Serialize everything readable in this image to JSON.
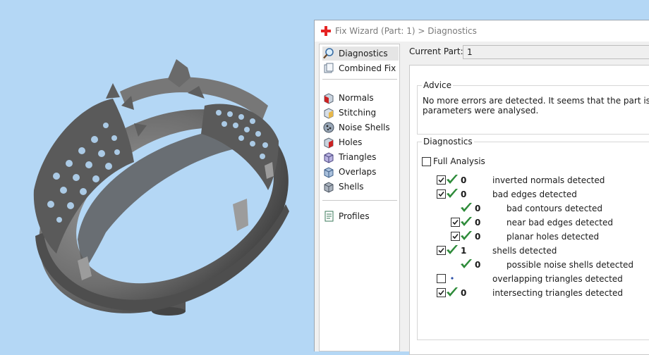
{
  "window": {
    "title": "Fix Wizard (Part: 1) > Diagnostics"
  },
  "nav": {
    "items": [
      {
        "label": "Diagnostics",
        "icon": "magnifier-icon",
        "selected": true
      },
      {
        "label": "Combined Fix",
        "icon": "combined-fix-icon"
      },
      {
        "label": "Normals",
        "icon": "normals-icon"
      },
      {
        "label": "Stitching",
        "icon": "stitching-icon"
      },
      {
        "label": "Noise Shells",
        "icon": "noise-shells-icon"
      },
      {
        "label": "Holes",
        "icon": "holes-icon"
      },
      {
        "label": "Triangles",
        "icon": "triangles-icon"
      },
      {
        "label": "Overlaps",
        "icon": "overlaps-icon"
      },
      {
        "label": "Shells",
        "icon": "shells-icon"
      },
      {
        "label": "Profiles",
        "icon": "profiles-icon"
      }
    ]
  },
  "current_part": {
    "label": "Current Part:",
    "value": "1"
  },
  "advice": {
    "title": "Advice",
    "line1": "No more errors are detected. It seems that the part is ok. Note",
    "line2": "parameters were analysed."
  },
  "diagnostics": {
    "title": "Diagnostics",
    "full_analysis_label": "Full Analysis",
    "full_analysis_checked": false,
    "rows": [
      {
        "checkbox": true,
        "checked": true,
        "status": "ok",
        "value": "0",
        "label": "inverted normals detected"
      },
      {
        "checkbox": true,
        "checked": true,
        "status": "ok",
        "value": "0",
        "label": "bad edges detected"
      },
      {
        "checkbox": false,
        "checked": false,
        "status": "ok",
        "value": "0",
        "label": "bad contours detected"
      },
      {
        "checkbox": true,
        "checked": true,
        "status": "ok",
        "value": "0",
        "label": "near bad edges detected"
      },
      {
        "checkbox": true,
        "checked": true,
        "status": "ok",
        "value": "0",
        "label": "planar holes detected"
      },
      {
        "checkbox": true,
        "checked": true,
        "status": "ok",
        "value": "1",
        "label": "shells detected"
      },
      {
        "checkbox": false,
        "checked": false,
        "status": "ok",
        "value": "0",
        "label": "possible noise shells detected"
      },
      {
        "checkbox": true,
        "checked": false,
        "status": "dot",
        "value": "",
        "label": "overlapping triangles detected"
      },
      {
        "checkbox": true,
        "checked": true,
        "status": "ok",
        "value": "0",
        "label": "intersecting triangles detected"
      }
    ]
  },
  "colors": {
    "viewport_bg": "#b4d7f5",
    "model_metal": "#6b6b6b",
    "check_green": "#2e8b3a",
    "title_icon_red": "#e52323"
  }
}
